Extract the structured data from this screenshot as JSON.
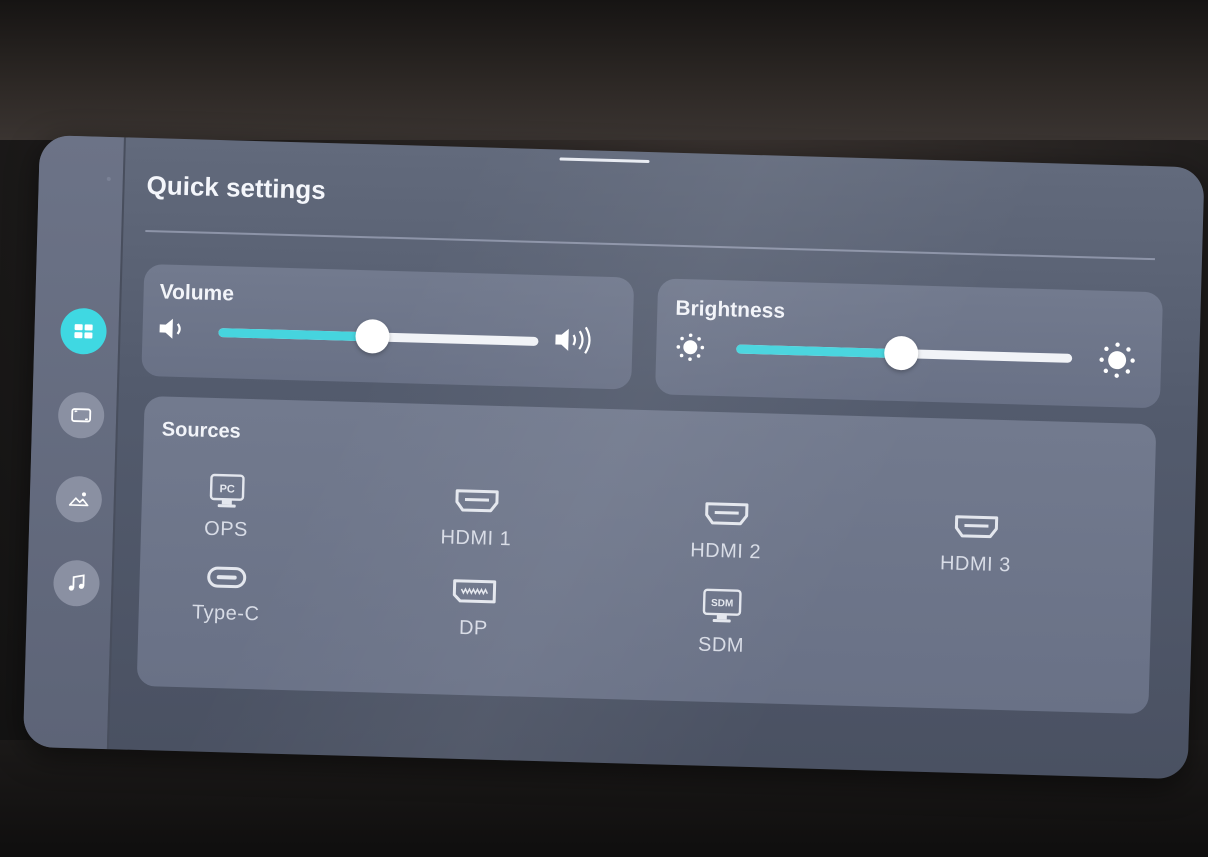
{
  "panel": {
    "title": "Quick settings"
  },
  "rail": {
    "items": [
      {
        "icon": "grid-icon",
        "active": true
      },
      {
        "icon": "screen-icon",
        "active": false
      },
      {
        "icon": "picture-icon",
        "active": false
      },
      {
        "icon": "music-note-icon",
        "active": false
      }
    ]
  },
  "volume": {
    "label": "Volume",
    "level": 0.48,
    "min_icon": "speaker-low-icon",
    "max_icon": "speaker-high-icon"
  },
  "brightness": {
    "label": "Brightness",
    "level": 0.49,
    "min_icon": "sun-low-icon",
    "max_icon": "sun-high-icon"
  },
  "sources": {
    "label": "Sources",
    "items": [
      {
        "label": "OPS",
        "icon": "pc-icon"
      },
      {
        "label": "HDMI 1",
        "icon": "hdmi-port-icon"
      },
      {
        "label": "HDMI 2",
        "icon": "hdmi-port-icon"
      },
      {
        "label": "HDMI 3",
        "icon": "hdmi-port-icon"
      },
      {
        "label": "Type-C",
        "icon": "usb-c-port-icon"
      },
      {
        "label": "DP",
        "icon": "displayport-icon"
      },
      {
        "label": "SDM",
        "icon": "sdm-icon"
      }
    ]
  },
  "colors": {
    "accent": "#46d4de",
    "panel": "#5a6174"
  }
}
